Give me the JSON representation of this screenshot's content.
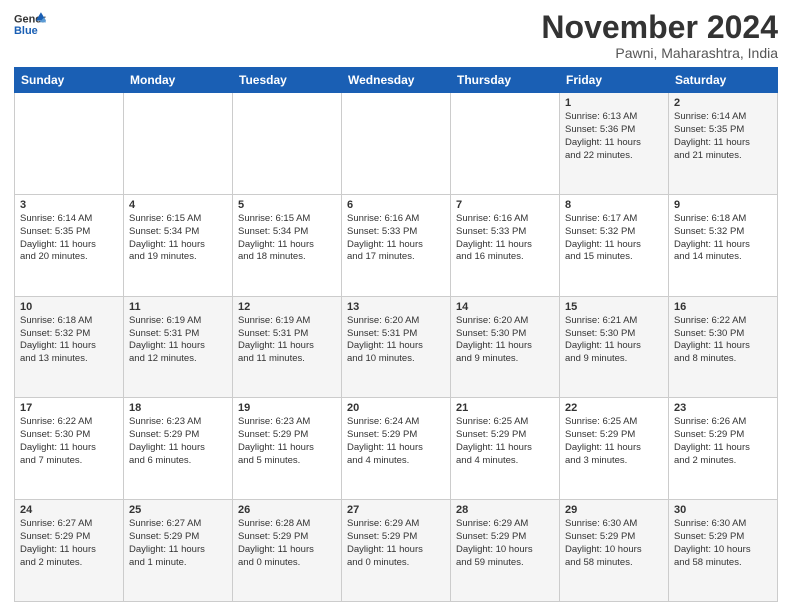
{
  "logo": {
    "line1": "General",
    "line2": "Blue"
  },
  "title": "November 2024",
  "subtitle": "Pawni, Maharashtra, India",
  "headers": [
    "Sunday",
    "Monday",
    "Tuesday",
    "Wednesday",
    "Thursday",
    "Friday",
    "Saturday"
  ],
  "rows": [
    [
      {
        "day": "",
        "info": ""
      },
      {
        "day": "",
        "info": ""
      },
      {
        "day": "",
        "info": ""
      },
      {
        "day": "",
        "info": ""
      },
      {
        "day": "",
        "info": ""
      },
      {
        "day": "1",
        "info": "Sunrise: 6:13 AM\nSunset: 5:36 PM\nDaylight: 11 hours\nand 22 minutes."
      },
      {
        "day": "2",
        "info": "Sunrise: 6:14 AM\nSunset: 5:35 PM\nDaylight: 11 hours\nand 21 minutes."
      }
    ],
    [
      {
        "day": "3",
        "info": "Sunrise: 6:14 AM\nSunset: 5:35 PM\nDaylight: 11 hours\nand 20 minutes."
      },
      {
        "day": "4",
        "info": "Sunrise: 6:15 AM\nSunset: 5:34 PM\nDaylight: 11 hours\nand 19 minutes."
      },
      {
        "day": "5",
        "info": "Sunrise: 6:15 AM\nSunset: 5:34 PM\nDaylight: 11 hours\nand 18 minutes."
      },
      {
        "day": "6",
        "info": "Sunrise: 6:16 AM\nSunset: 5:33 PM\nDaylight: 11 hours\nand 17 minutes."
      },
      {
        "day": "7",
        "info": "Sunrise: 6:16 AM\nSunset: 5:33 PM\nDaylight: 11 hours\nand 16 minutes."
      },
      {
        "day": "8",
        "info": "Sunrise: 6:17 AM\nSunset: 5:32 PM\nDaylight: 11 hours\nand 15 minutes."
      },
      {
        "day": "9",
        "info": "Sunrise: 6:18 AM\nSunset: 5:32 PM\nDaylight: 11 hours\nand 14 minutes."
      }
    ],
    [
      {
        "day": "10",
        "info": "Sunrise: 6:18 AM\nSunset: 5:32 PM\nDaylight: 11 hours\nand 13 minutes."
      },
      {
        "day": "11",
        "info": "Sunrise: 6:19 AM\nSunset: 5:31 PM\nDaylight: 11 hours\nand 12 minutes."
      },
      {
        "day": "12",
        "info": "Sunrise: 6:19 AM\nSunset: 5:31 PM\nDaylight: 11 hours\nand 11 minutes."
      },
      {
        "day": "13",
        "info": "Sunrise: 6:20 AM\nSunset: 5:31 PM\nDaylight: 11 hours\nand 10 minutes."
      },
      {
        "day": "14",
        "info": "Sunrise: 6:20 AM\nSunset: 5:30 PM\nDaylight: 11 hours\nand 9 minutes."
      },
      {
        "day": "15",
        "info": "Sunrise: 6:21 AM\nSunset: 5:30 PM\nDaylight: 11 hours\nand 9 minutes."
      },
      {
        "day": "16",
        "info": "Sunrise: 6:22 AM\nSunset: 5:30 PM\nDaylight: 11 hours\nand 8 minutes."
      }
    ],
    [
      {
        "day": "17",
        "info": "Sunrise: 6:22 AM\nSunset: 5:30 PM\nDaylight: 11 hours\nand 7 minutes."
      },
      {
        "day": "18",
        "info": "Sunrise: 6:23 AM\nSunset: 5:29 PM\nDaylight: 11 hours\nand 6 minutes."
      },
      {
        "day": "19",
        "info": "Sunrise: 6:23 AM\nSunset: 5:29 PM\nDaylight: 11 hours\nand 5 minutes."
      },
      {
        "day": "20",
        "info": "Sunrise: 6:24 AM\nSunset: 5:29 PM\nDaylight: 11 hours\nand 4 minutes."
      },
      {
        "day": "21",
        "info": "Sunrise: 6:25 AM\nSunset: 5:29 PM\nDaylight: 11 hours\nand 4 minutes."
      },
      {
        "day": "22",
        "info": "Sunrise: 6:25 AM\nSunset: 5:29 PM\nDaylight: 11 hours\nand 3 minutes."
      },
      {
        "day": "23",
        "info": "Sunrise: 6:26 AM\nSunset: 5:29 PM\nDaylight: 11 hours\nand 2 minutes."
      }
    ],
    [
      {
        "day": "24",
        "info": "Sunrise: 6:27 AM\nSunset: 5:29 PM\nDaylight: 11 hours\nand 2 minutes."
      },
      {
        "day": "25",
        "info": "Sunrise: 6:27 AM\nSunset: 5:29 PM\nDaylight: 11 hours\nand 1 minute."
      },
      {
        "day": "26",
        "info": "Sunrise: 6:28 AM\nSunset: 5:29 PM\nDaylight: 11 hours\nand 0 minutes."
      },
      {
        "day": "27",
        "info": "Sunrise: 6:29 AM\nSunset: 5:29 PM\nDaylight: 11 hours\nand 0 minutes."
      },
      {
        "day": "28",
        "info": "Sunrise: 6:29 AM\nSunset: 5:29 PM\nDaylight: 10 hours\nand 59 minutes."
      },
      {
        "day": "29",
        "info": "Sunrise: 6:30 AM\nSunset: 5:29 PM\nDaylight: 10 hours\nand 58 minutes."
      },
      {
        "day": "30",
        "info": "Sunrise: 6:30 AM\nSunset: 5:29 PM\nDaylight: 10 hours\nand 58 minutes."
      }
    ]
  ]
}
